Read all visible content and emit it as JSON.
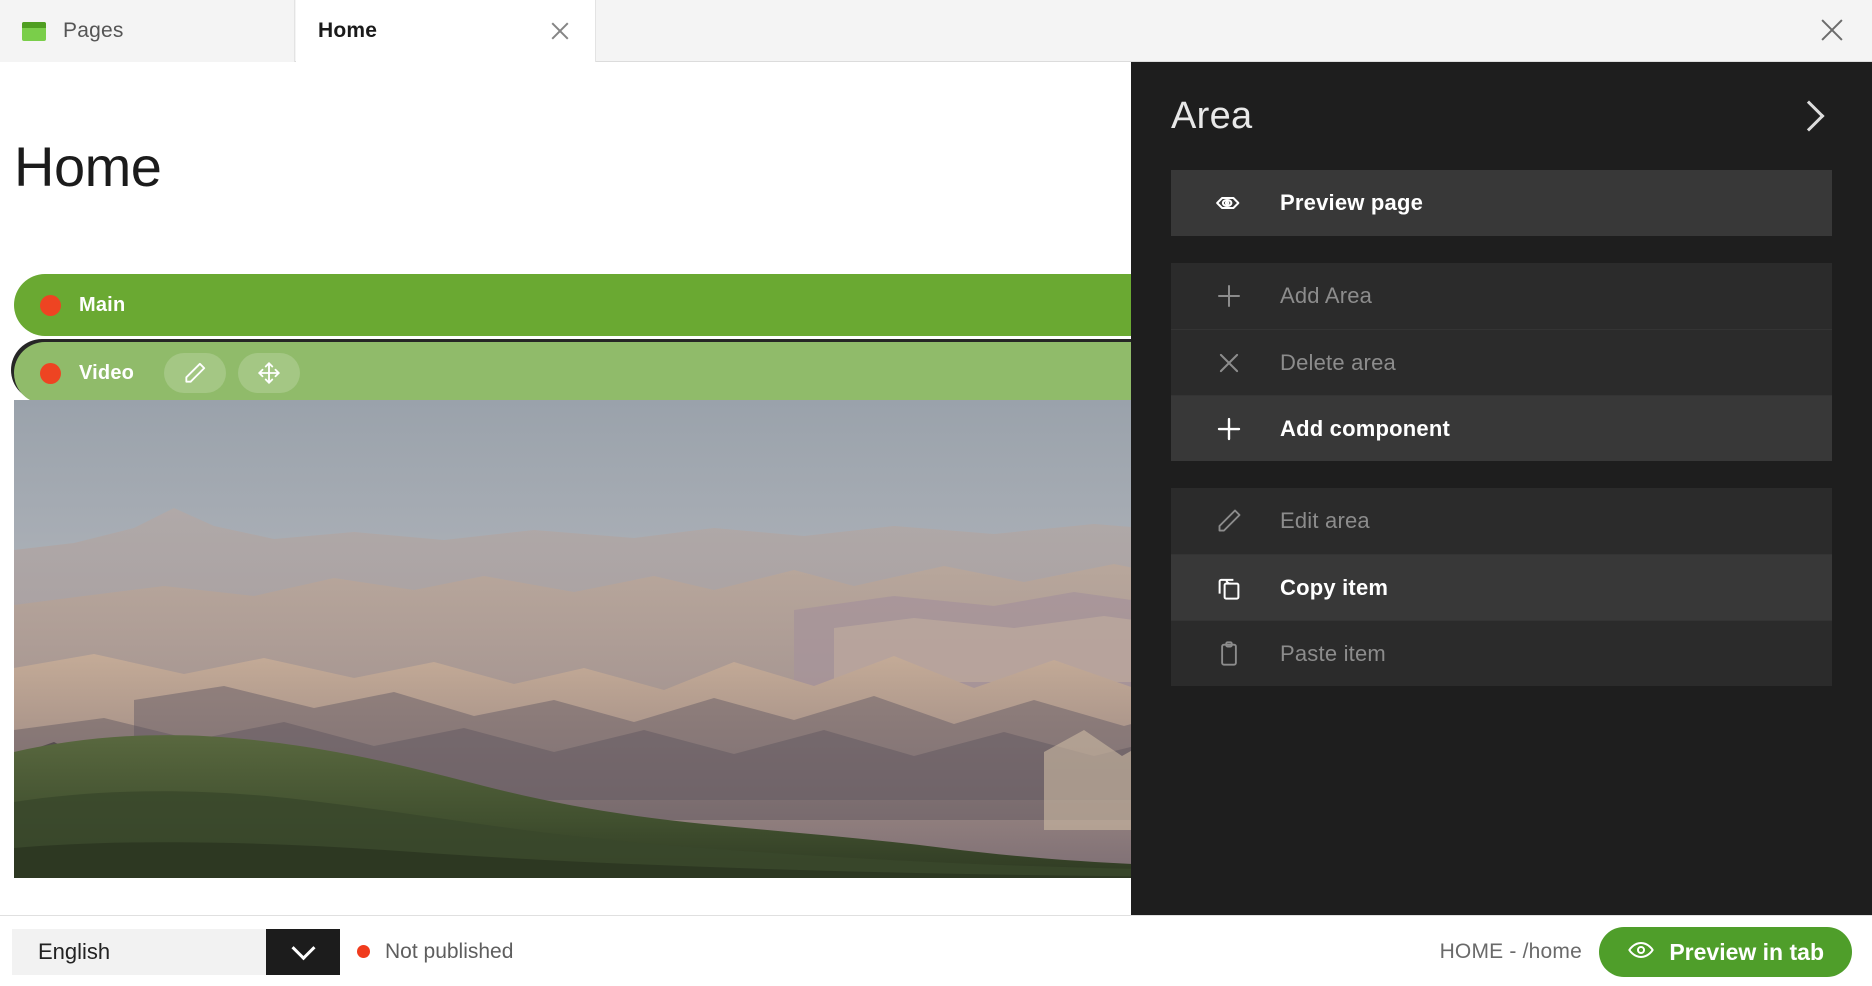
{
  "tabbar": {
    "pages_tab": {
      "label": "Pages",
      "icon": "pages-icon"
    },
    "home_tab": {
      "label": "Home",
      "close_icon": "close-icon"
    },
    "window_close_icon": "close-icon"
  },
  "canvas": {
    "page_title": "Home",
    "bars": [
      {
        "label": "Main",
        "dot_color": "#ee4422",
        "bg": "#6aa932",
        "actions": []
      },
      {
        "label": "Video",
        "dot_color": "#ee4422",
        "bg": "#90bb6a",
        "actions": [
          {
            "name": "edit-icon",
            "title": "Edit"
          },
          {
            "name": "move-icon",
            "title": "Move"
          }
        ]
      }
    ],
    "media": {
      "alt": "Canyon landscape video preview"
    }
  },
  "panel": {
    "title": "Area",
    "expand_icon": "chevron-right-icon",
    "groups": [
      {
        "items": [
          {
            "label": "Preview page",
            "icon": "preview-tag-icon",
            "enabled": true
          }
        ]
      },
      {
        "items": [
          {
            "label": "Add Area",
            "icon": "plus-icon",
            "enabled": false
          },
          {
            "label": "Delete area",
            "icon": "close-icon",
            "enabled": false
          },
          {
            "label": "Add component",
            "icon": "plus-icon",
            "enabled": true
          }
        ]
      },
      {
        "items": [
          {
            "label": "Edit area",
            "icon": "pencil-icon",
            "enabled": false
          },
          {
            "label": "Copy item",
            "icon": "copy-icon",
            "enabled": true
          },
          {
            "label": "Paste item",
            "icon": "clipboard-icon",
            "enabled": false
          }
        ]
      }
    ]
  },
  "statusbar": {
    "language": "English",
    "language_dropdown_icon": "chevron-down-icon",
    "publish_status": "Not published",
    "publish_dot_color": "#f03b1d",
    "path": "HOME - /home",
    "preview_button": {
      "label": "Preview in tab",
      "icon": "eye-icon",
      "color": "#4f9e2a"
    }
  }
}
